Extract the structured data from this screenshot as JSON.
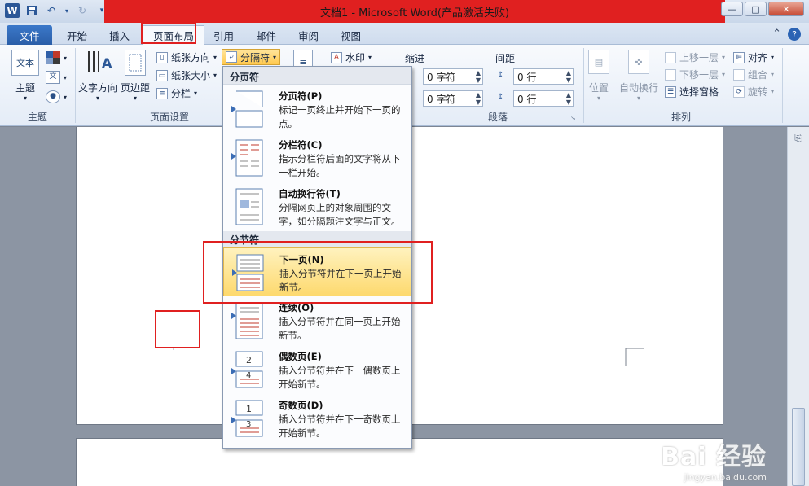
{
  "window": {
    "title": "文档1 - Microsoft Word(产品激活失败)",
    "logo": "W",
    "controls": [
      "—",
      "□",
      "✕"
    ]
  },
  "tabs": [
    {
      "label": "文件"
    },
    {
      "label": "开始"
    },
    {
      "label": "插入"
    },
    {
      "label": "页面布局"
    },
    {
      "label": "引用"
    },
    {
      "label": "邮件"
    },
    {
      "label": "审阅"
    },
    {
      "label": "视图"
    }
  ],
  "ribbon": {
    "theme": {
      "button": "主题",
      "icon_text": "文本",
      "group": "主题"
    },
    "page_setup": {
      "text_direction": "文字方向",
      "margins": "页边距",
      "orientation": "纸张方向",
      "size": "纸张大小",
      "columns": "分栏",
      "breaks": "分隔符",
      "group": "页面设置"
    },
    "watermark": "水印",
    "paragraph": {
      "indent_label": "缩进",
      "spacing_label": "间距",
      "indent_left": "0 字符",
      "indent_right": "0 字符",
      "spacing_before": "0 行",
      "spacing_after": "0 行",
      "group": "段落"
    },
    "arrange": {
      "position": "位置",
      "wrap": "自动换行",
      "bring_forward": "上移一层",
      "send_backward": "下移一层",
      "selection_pane": "选择窗格",
      "align": "对齐",
      "group_cmd": "组合",
      "rotate": "旋转",
      "group": "排列"
    }
  },
  "menu": {
    "header_page": "分页符",
    "header_section": "分节符",
    "page_breaks": [
      {
        "title": "分页符(P)",
        "desc": "标记一页终止并开始下一页的点。"
      },
      {
        "title": "分栏符(C)",
        "desc": "指示分栏符后面的文字将从下一栏开始。"
      },
      {
        "title": "自动换行符(T)",
        "desc": "分隔网页上的对象周围的文字，如分隔题注文字与正文。"
      }
    ],
    "section_breaks": [
      {
        "title": "下一页(N)",
        "desc": "插入分节符并在下一页上开始新节。",
        "highlighted": true
      },
      {
        "title": "连续(O)",
        "desc": "插入分节符并在同一页上开始新节。"
      },
      {
        "title": "偶数页(E)",
        "desc": "插入分节符并在下一偶数页上开始新节。",
        "badge": "4"
      },
      {
        "title": "奇数页(D)",
        "desc": "插入分节符并在下一奇数页上开始新节。",
        "badge": "3"
      }
    ]
  },
  "watermark": {
    "main": "Bai 经验",
    "sub": "jingyan.baidu.com"
  },
  "colors": {
    "highlight_box": "#e02020",
    "accent": "#2b5797"
  }
}
